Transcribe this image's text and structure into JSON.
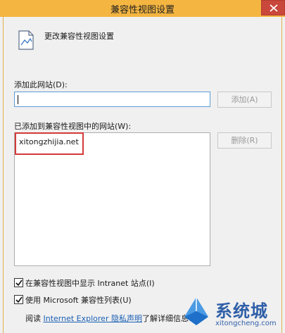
{
  "window": {
    "title": "兼容性视图设置"
  },
  "header": {
    "heading": "更改兼容性视图设置"
  },
  "add_section": {
    "label": "添加此网站(D):",
    "input_value": "",
    "add_button": "添加(A)"
  },
  "list_section": {
    "label": "已添加到兼容性视图中的网站(W):",
    "items": [
      "xitongzhijia.net"
    ],
    "delete_button": "删除(R)"
  },
  "options": {
    "intranet_label": "在兼容性视图中显示 Intranet 站点(I)",
    "intranet_checked": true,
    "mslist_label": "使用 Microsoft 兼容性列表(U)",
    "mslist_checked": true
  },
  "privacy": {
    "prefix": "阅读",
    "link": "Internet Explorer 隐私声明",
    "suffix": "了解详细信息"
  },
  "watermark": {
    "brand": "系统城",
    "url": "xitongcheng.com"
  },
  "colors": {
    "titlebar": "#f4b541",
    "close": "#c9473b",
    "highlight": "#d33a3a",
    "link": "#1a5fb4"
  }
}
